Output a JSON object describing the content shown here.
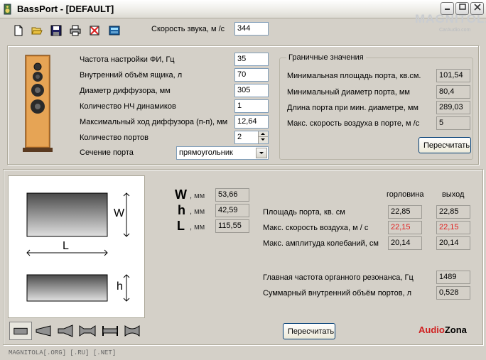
{
  "window": {
    "title": "BassPort - [DEFAULT]",
    "watermark": "MAGNITOLA",
    "watermark_sub": "CarAudio.com"
  },
  "toolbar": {
    "sound_speed_label": "Скорость звука, м /с",
    "sound_speed_value": "344"
  },
  "inputs": {
    "items": [
      {
        "label": "Частота настройки ФИ, Гц",
        "value": "35"
      },
      {
        "label": "Внутренний объём ящика, л",
        "value": "70"
      },
      {
        "label": "Диаметр диффузора, мм",
        "value": "305"
      },
      {
        "label": "Количество НЧ динамиков",
        "value": "1"
      },
      {
        "label": "Максимальный ход диффузора (п-п), мм",
        "value": "12,64"
      },
      {
        "label": "Количество портов",
        "value": "2"
      }
    ],
    "section_label": "Сечение порта",
    "section_value": "прямоугольник"
  },
  "limits": {
    "title": "Граничные значения",
    "items": [
      {
        "label": "Минимальная площадь порта, кв.см.",
        "value": "101,54"
      },
      {
        "label": "Минимальный диаметр порта, мм",
        "value": "80,4"
      },
      {
        "label": "Длина порта при мин. диаметре, мм",
        "value": "289,03"
      },
      {
        "label": "Макс. скорость воздуха в порте, м /с",
        "value": "5"
      }
    ],
    "recalc_label": "Пересчитать"
  },
  "dims": {
    "w_letter": "W",
    "h_letter": "h",
    "l_letter": "L",
    "unit": ", мм",
    "w_value": "53,66",
    "h_value": "42,59",
    "l_value": "115,55"
  },
  "diagram": {
    "w": "W",
    "l": "L",
    "h": "h"
  },
  "results": {
    "col_throat": "горловина",
    "col_exit": "выход",
    "rows": [
      {
        "label": "Площадь порта, кв. см",
        "throat": "22,85",
        "exit": "22,85"
      },
      {
        "label": "Макс. скорость воздуха, м / с",
        "throat": "22,15",
        "exit": "22,15"
      },
      {
        "label": "Макс. амплитуда колебаний, см",
        "throat": "20,14",
        "exit": "20,14"
      }
    ],
    "resonance_label": "Главная частота органного резонанса, Гц",
    "resonance_value": "1489",
    "volume_label": "Суммарный внутренний объём портов, л",
    "volume_value": "0,528",
    "recalc_label": "Пересчитать"
  },
  "brand": {
    "part1": "Audio",
    "part2": "Zona"
  },
  "footer": "MAGNITOLA[.ORG] [.RU] [.NET]",
  "colors": {
    "warning": "#e02020",
    "dialog_bg": "#d4d0c8"
  }
}
